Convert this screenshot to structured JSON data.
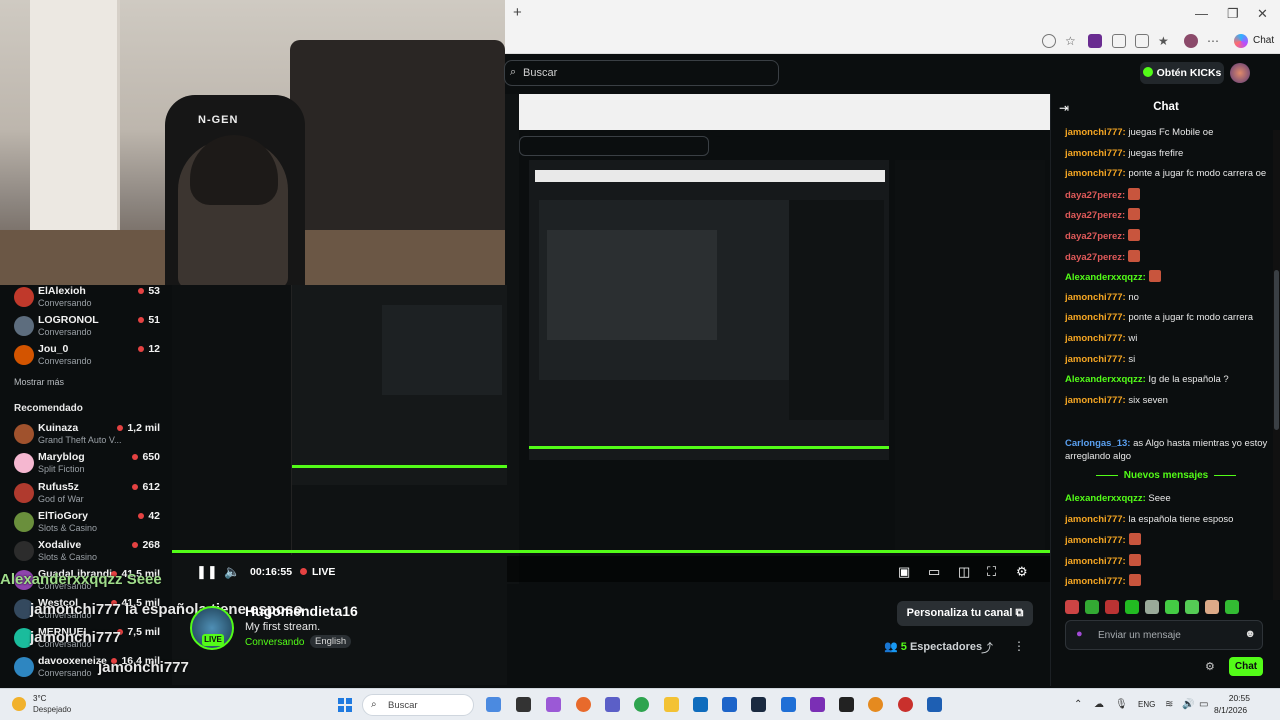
{
  "browser": {
    "new_tab": "+",
    "window_controls": [
      "—",
      "❐",
      "✕"
    ],
    "chat_ext_label": "Chat"
  },
  "header": {
    "search_placeholder": "Buscar",
    "kicks_button": "Obtén KICKs"
  },
  "sidebar": {
    "following": [
      {
        "name": "ElAlexioh",
        "sub": "Conversando",
        "count": "53",
        "color": "#c0392b"
      },
      {
        "name": "LOGRONOL",
        "sub": "Conversando",
        "count": "51",
        "color": "#5d6d7e"
      },
      {
        "name": "Jou_0",
        "sub": "Conversando",
        "count": "12",
        "color": "#d35400"
      }
    ],
    "show_more": "Mostrar más",
    "recommended_title": "Recomendado",
    "recommended": [
      {
        "name": "Kuinaza",
        "sub": "Grand Theft Auto V...",
        "count": "1,2 mil",
        "color": "#a0522d"
      },
      {
        "name": "Maryblog",
        "sub": "Split Fiction",
        "count": "650",
        "color": "#f5b7d0"
      },
      {
        "name": "Rufus5z",
        "sub": "God of War",
        "count": "612",
        "color": "#b03a2e"
      },
      {
        "name": "ElTioGory",
        "sub": "Slots & Casino",
        "count": "42",
        "color": "#6a8f3c"
      },
      {
        "name": "Xodalive",
        "sub": "Slots & Casino",
        "count": "268",
        "color": "#2c2c2c"
      },
      {
        "name": "GuadaLibrandi",
        "sub": "Conversando",
        "count": "41,5 mil",
        "color": "#8e44ad"
      },
      {
        "name": "Westcol",
        "sub": "Conversando",
        "count": "41,5 mil",
        "color": "#34495e"
      },
      {
        "name": "MERNUEL",
        "sub": "Conversando",
        "count": "7,5 mil",
        "color": "#1abc9c"
      },
      {
        "name": "davooxeneize",
        "sub": "Conversando",
        "count": "16,4 mil",
        "color": "#2e86c1"
      }
    ]
  },
  "webcam": {
    "chair_logo": "N-GEN"
  },
  "player": {
    "time": "00:16:55",
    "live": "LIVE"
  },
  "overlay_chat": [
    {
      "text": "Alexanderxxqqzz  Seee"
    },
    {
      "text": "jamonchi777  la española tiene esposo"
    },
    {
      "text": "jamonchi777"
    },
    {
      "text": "jamonchi777"
    }
  ],
  "stream": {
    "streamer": "Hugomendieta16",
    "title": "My first stream.",
    "category": "Conversando",
    "language": "English",
    "live_badge": "LIVE",
    "customize": "Personaliza tu canal",
    "viewers_count": "5",
    "viewers_label": "Espectadores"
  },
  "chat": {
    "title": "Chat",
    "messages": [
      {
        "user": "jamonchi777",
        "text": "juegas Fc Mobile oe",
        "color": "#f5a623",
        "emote": false
      },
      {
        "user": "jamonchi777",
        "text": "juegas frefire",
        "color": "#f5a623",
        "emote": false
      },
      {
        "user": "jamonchi777",
        "text": "ponte a jugar fc modo carrera oe",
        "color": "#f5a623",
        "emote": false
      },
      {
        "user": "daya27perez",
        "text": "",
        "color": "#e05a5a",
        "emote": true
      },
      {
        "user": "daya27perez",
        "text": "",
        "color": "#e05a5a",
        "emote": true
      },
      {
        "user": "daya27perez",
        "text": "",
        "color": "#e05a5a",
        "emote": true
      },
      {
        "user": "daya27perez",
        "text": "",
        "color": "#e05a5a",
        "emote": true
      },
      {
        "user": "Alexanderxxqqzz",
        "text": "",
        "color": "#53fc18",
        "emote": true
      },
      {
        "user": "jamonchi777",
        "text": "no",
        "color": "#f5a623",
        "emote": false
      },
      {
        "user": "jamonchi777",
        "text": "ponte a jugar fc modo carrera",
        "color": "#f5a623",
        "emote": false
      },
      {
        "user": "jamonchi777",
        "text": "wi",
        "color": "#f5a623",
        "emote": false
      },
      {
        "user": "jamonchi777",
        "text": "si",
        "color": "#f5a623",
        "emote": false
      },
      {
        "user": "Alexanderxxqqzz",
        "text": "Ig de la española ?",
        "color": "#53fc18",
        "emote": false
      },
      {
        "user": "jamonchi777",
        "text": "six seven",
        "color": "#f5a623",
        "emote": false
      },
      {
        "user": "Carlongas_13",
        "text": "as Algo hasta mientras yo estoy arreglando algo",
        "color": "#5aa0f0",
        "emote": false
      }
    ],
    "new_messages": "Nuevos mensajes",
    "new": [
      {
        "user": "Alexanderxxqqzz",
        "text": "Seee",
        "color": "#53fc18",
        "emote": false
      },
      {
        "user": "jamonchi777",
        "text": "la española tiene esposo",
        "color": "#f5a623",
        "emote": false
      },
      {
        "user": "jamonchi777",
        "text": "",
        "color": "#f5a623",
        "emote": true
      },
      {
        "user": "jamonchi777",
        "text": "",
        "color": "#f5a623",
        "emote": true
      },
      {
        "user": "jamonchi777",
        "text": "",
        "color": "#f5a623",
        "emote": true
      }
    ],
    "input_placeholder": "Enviar un mensaje",
    "send": "Chat"
  },
  "taskbar": {
    "temp": "3°C",
    "weather": "Despejado",
    "search": "Buscar",
    "lang": "ENG",
    "time": "20:55",
    "date": "8/1/2026"
  }
}
